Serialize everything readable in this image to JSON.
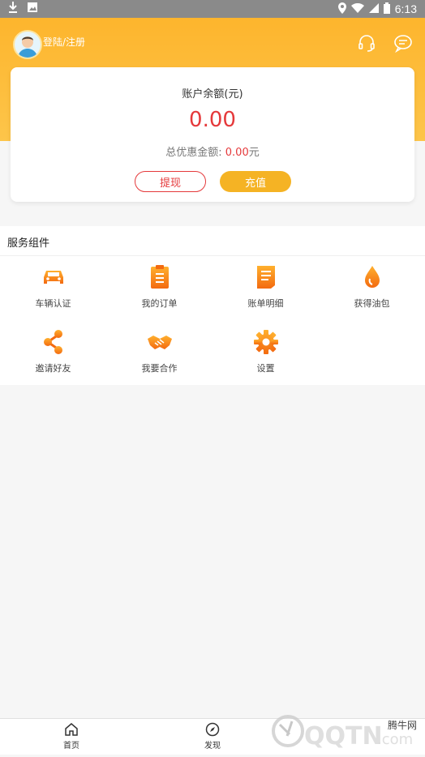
{
  "status_bar": {
    "time": "6:13"
  },
  "header": {
    "login_text": "登陆/注册"
  },
  "balance_card": {
    "title": "账户余额(元)",
    "amount": "0.00",
    "discount_label": "总优惠金额: ",
    "discount_value": "0.00",
    "discount_unit": "元",
    "withdraw_label": "提现",
    "recharge_label": "充值"
  },
  "services": {
    "title": "服务组件",
    "items": [
      {
        "label": "车辆认证",
        "icon": "car-icon"
      },
      {
        "label": "我的订单",
        "icon": "clipboard-icon"
      },
      {
        "label": "账单明细",
        "icon": "bill-icon"
      },
      {
        "label": "获得油包",
        "icon": "oil-drop-icon"
      },
      {
        "label": "邀请好友",
        "icon": "share-icon"
      },
      {
        "label": "我要合作",
        "icon": "handshake-icon"
      },
      {
        "label": "设置",
        "icon": "gear-icon"
      }
    ]
  },
  "bottom_tabs": [
    {
      "label": "首页",
      "icon": "home-icon"
    },
    {
      "label": "发现",
      "icon": "compass-icon"
    }
  ],
  "watermark": {
    "text": "腾牛网"
  },
  "colors": {
    "accent": "#f5b324",
    "amount_red": "#e5393b"
  }
}
